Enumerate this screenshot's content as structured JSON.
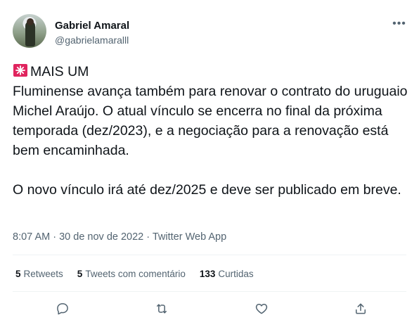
{
  "author": {
    "name": "Gabriel Amaral",
    "handle": "@gabrielamaralll",
    "more_icon": "more-horizontal-icon"
  },
  "tweet": {
    "emoji": "rotating-light-siren",
    "headline": "MAIS UM",
    "paragraph1": "Fluminense avança também para renovar o contrato do uruguaio Michel Araújo. O atual vínculo se encerra no final da próxima temporada (dez/2023), e a negociação para a renovação está bem encaminhada.",
    "paragraph2": "O novo vínculo irá até dez/2025 e deve ser publicado em breve."
  },
  "meta": {
    "time": "8:07 AM",
    "separator1": " · ",
    "date": "30 de nov de 2022",
    "separator2": " · ",
    "source": "Twitter Web App"
  },
  "stats": {
    "retweets_count": "5",
    "retweets_label": "Retweets",
    "quotes_count": "5",
    "quotes_label": "Tweets com comentário",
    "likes_count": "133",
    "likes_label": "Curtidas"
  },
  "actions": [
    "reply-icon",
    "retweet-icon",
    "like-icon",
    "share-icon"
  ],
  "colors": {
    "text": "#0f1419",
    "secondary": "#536471",
    "divider": "#eff3f4",
    "siren": "#e0245e"
  }
}
